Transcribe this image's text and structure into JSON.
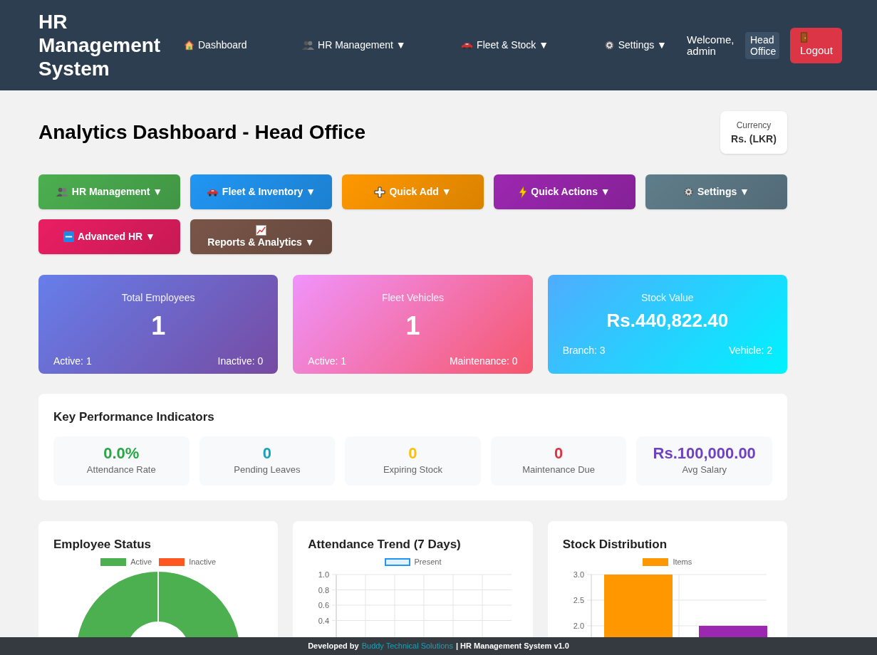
{
  "header": {
    "title": "HR Management System",
    "nav": [
      {
        "label": "Dashboard"
      },
      {
        "label": "HR Management ▼"
      },
      {
        "label": "Fleet & Stock ▼"
      },
      {
        "label": "Settings ▼"
      }
    ],
    "welcome": "Welcome, admin",
    "branch": "Head Office",
    "logout": "Logout"
  },
  "page_title": "Analytics Dashboard - Head Office",
  "currency": {
    "label": "Currency",
    "value": "Rs. (LKR)"
  },
  "action_buttons": [
    {
      "label": "HR Management ▼",
      "color": "#4caf50"
    },
    {
      "label": "Fleet & Inventory ▼",
      "color": "#2196f3"
    },
    {
      "label": "Quick Add ▼",
      "color": "#ff9800"
    },
    {
      "label": "Quick Actions ▼",
      "color": "#9c27b0"
    },
    {
      "label": "Settings ▼",
      "color": "#607d8b"
    },
    {
      "label": "Advanced HR ▼",
      "color": "#e91e63"
    },
    {
      "label": "Reports & Analytics ▼",
      "color": "#795548"
    }
  ],
  "stat_cards": [
    {
      "title": "Total Employees",
      "value": "1",
      "left": "Active: 1",
      "right": "Inactive: 0"
    },
    {
      "title": "Fleet Vehicles",
      "value": "1",
      "left": "Active: 1",
      "right": "Maintenance: 0"
    },
    {
      "title": "Stock Value",
      "value": "Rs.440,822.40",
      "left": "Branch: 3",
      "right": "Vehicle: 2"
    }
  ],
  "kpi": {
    "title": "Key Performance Indicators",
    "items": [
      {
        "value": "0.0%",
        "label": "Attendance Rate",
        "color": "#28a745"
      },
      {
        "value": "0",
        "label": "Pending Leaves",
        "color": "#17a2b8"
      },
      {
        "value": "0",
        "label": "Expiring Stock",
        "color": "#ffc107"
      },
      {
        "value": "0",
        "label": "Maintenance Due",
        "color": "#dc3545"
      },
      {
        "value": "Rs.100,000.00",
        "label": "Avg Salary",
        "color": "#6f42c1"
      }
    ]
  },
  "charts": [
    {
      "title": "Employee Status",
      "legend": [
        {
          "label": "Active",
          "color": "#4caf50"
        },
        {
          "label": "Inactive",
          "color": "#ff5722"
        }
      ]
    },
    {
      "title": "Attendance Trend (7 Days)",
      "legend": [
        {
          "label": "Present",
          "color": "#2196f3"
        }
      ],
      "y_labels": [
        "1.0",
        "0.8",
        "0.6",
        "0.4"
      ]
    },
    {
      "title": "Stock Distribution",
      "legend": [
        {
          "label": "Items",
          "color": "#ff9800"
        }
      ],
      "y_labels": [
        "3.0",
        "2.5",
        "2.0"
      ]
    }
  ],
  "footer": {
    "prefix": "Developed by",
    "link": "Buddy Technical Solutions",
    "suffix": "| HR Management System v1.0"
  }
}
